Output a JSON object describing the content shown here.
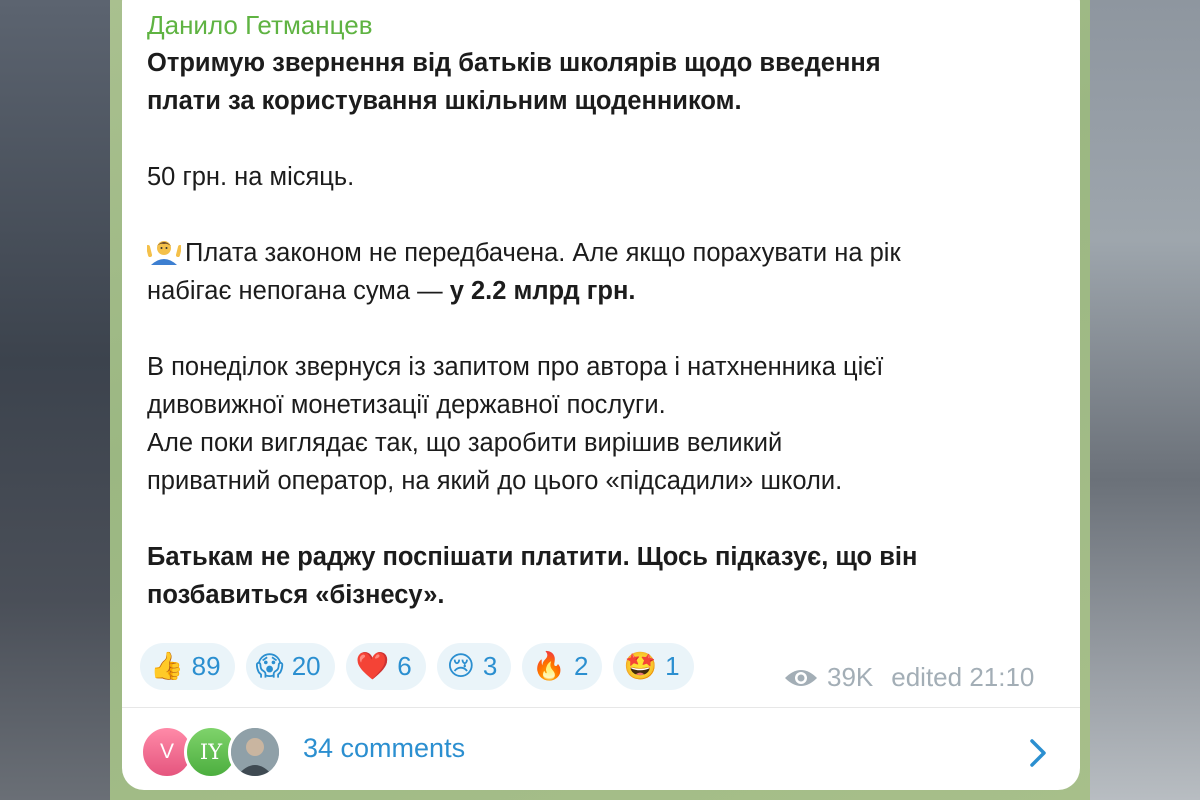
{
  "post": {
    "author": "Данило Гетманцев",
    "line1": "Отримую звернення від батьків школярів щодо введення",
    "line2": "плати за користування шкільним щоденником.",
    "price": "50 грн. на місяць.",
    "law_line": "Плата законом не передбачена. Але якщо порахувати на рік",
    "sum_prefix": "набігає непогана сума — ",
    "sum_bold": "у 2.2 млрд грн.",
    "p4_line1": "В понеділок звернуся із запитом про автора і натхненника цієї",
    "p4_line2": "дивовижної монетизації державної послуги.",
    "p4_line3": "Але поки виглядає так, що заробити вирішив великий",
    "p4_line4": "приватний оператор, на який до цього «підсадили» школи.",
    "final_line1": "Батькам не раджу поспішати платити. Щось підказує, що він",
    "final_line2": "позбавиться «бізнесу».",
    "shrug_emoji_icon": "person-shrugging-icon"
  },
  "reactions": [
    {
      "icon": "👍",
      "count": "89"
    },
    {
      "icon": "😱",
      "count": "20"
    },
    {
      "icon": "❤️",
      "count": "6"
    },
    {
      "icon": "😢",
      "count": "3"
    },
    {
      "icon": "🔥",
      "count": "2"
    },
    {
      "icon": "🤩",
      "count": "1"
    }
  ],
  "meta": {
    "views": "39K",
    "edited": "edited 21:10"
  },
  "comments": {
    "avatar1_initial": "V",
    "avatar2_initials": "IY",
    "label": "34 comments"
  },
  "colors": {
    "author": "#5fb342",
    "link": "#2b8fd0",
    "meta": "#a3aeb6"
  }
}
